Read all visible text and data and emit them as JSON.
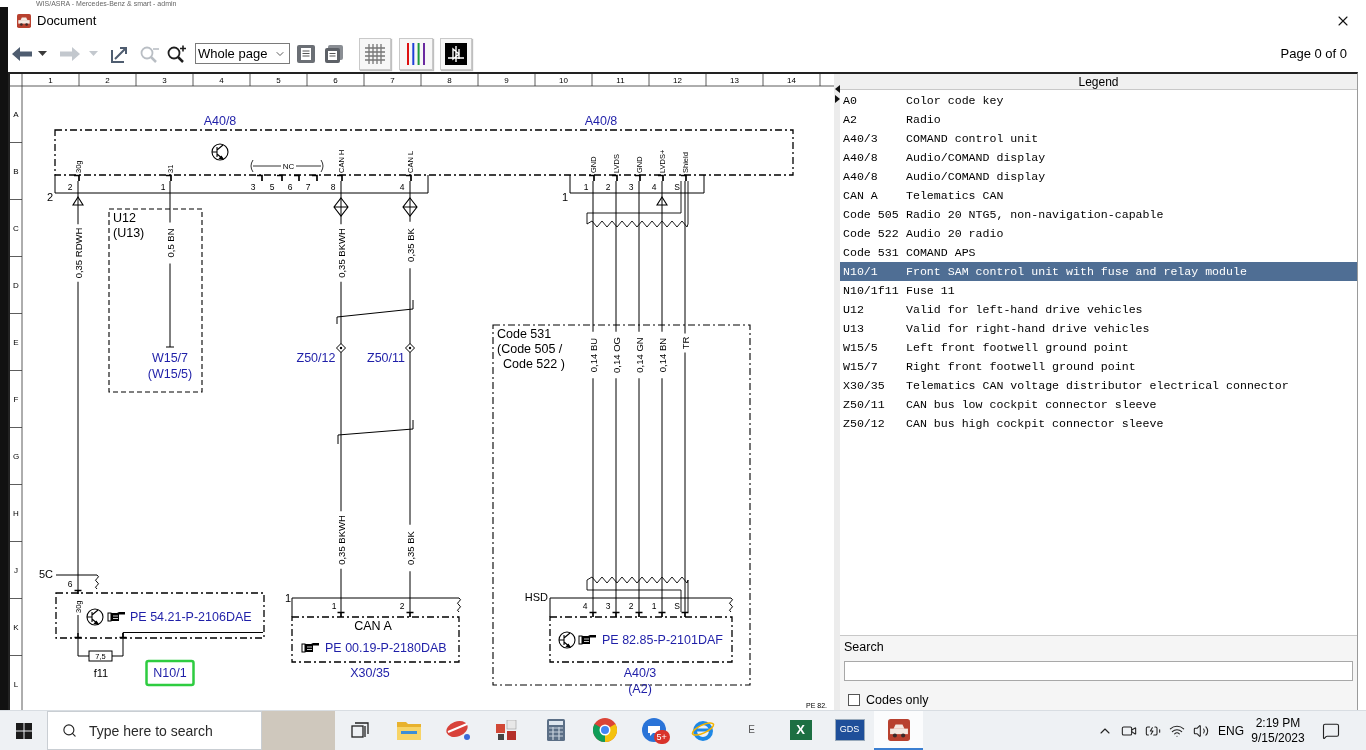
{
  "background_window": {
    "title": "WIS/ASRA - Mercedes-Benz & smart - admin"
  },
  "window": {
    "title": "Document"
  },
  "toolbar": {
    "buttons": [
      {
        "kind": "back",
        "disabled": false
      },
      {
        "kind": "menu",
        "disabled": false
      },
      {
        "kind": "forward",
        "disabled": true
      },
      {
        "kind": "menu",
        "disabled": true
      },
      {
        "kind": "fit",
        "disabled": false
      },
      {
        "kind": "zoom_out",
        "disabled": true
      },
      {
        "kind": "zoom_in",
        "disabled": false
      }
    ],
    "zoom": {
      "value": "Whole page"
    },
    "page_views": [
      {
        "kind": "single"
      },
      {
        "kind": "multiple"
      }
    ],
    "tools": [
      {
        "kind": "grid"
      },
      {
        "kind": "colors"
      },
      {
        "kind": "symbol"
      }
    ],
    "page_indicator": "Page 0 of 0"
  },
  "diagram": {
    "column_labels": [
      "1",
      "2",
      "3",
      "4",
      "5",
      "6",
      "7",
      "8",
      "9",
      "10",
      "11",
      "12",
      "13",
      "14"
    ],
    "row_labels": [
      "A",
      "B",
      "C",
      "D",
      "E",
      "F",
      "G",
      "H",
      "J",
      "K",
      "L"
    ],
    "component_labels": [
      {
        "text": "A40/8",
        "highlighted": false
      },
      {
        "text": "A40/8",
        "highlighted": false
      },
      {
        "text": "W15/7",
        "highlighted": false
      },
      {
        "text": "(W15/5)",
        "highlighted": false
      },
      {
        "text": "Z50/12",
        "highlighted": false
      },
      {
        "text": "Z50/11",
        "highlighted": false
      },
      {
        "text": "N10/1",
        "highlighted": true
      },
      {
        "text": "X30/35",
        "highlighted": false
      },
      {
        "text": "A40/3",
        "highlighted": false
      },
      {
        "text": "(A2)",
        "highlighted": false
      }
    ],
    "notes": [
      "U12",
      "(U13)",
      "Code 531",
      "(Code 505 /",
      "Code 522 )",
      "CAN A",
      "f11"
    ],
    "connectors": [
      {
        "label": "2",
        "pins": [
          {
            "number": "2",
            "name": "30g"
          },
          {
            "number": "1",
            "name": "31"
          },
          {
            "number": "3"
          },
          {
            "number": "5"
          },
          {
            "number": "6"
          },
          {
            "number": "7"
          },
          {
            "number": "8",
            "name": "CAN H"
          },
          {
            "number": "4",
            "name": "CAN L"
          }
        ]
      },
      {
        "label": "1",
        "pins": [
          {
            "number": "1",
            "name": "GND"
          },
          {
            "number": "2",
            "name": "LVDS"
          },
          {
            "number": "3",
            "name": "GND"
          },
          {
            "number": "4",
            "name": "LVDS+"
          },
          {
            "number": "S",
            "name": "Shield"
          }
        ]
      },
      {
        "label": "5C",
        "pins": [
          {
            "number": "6",
            "name": "30g"
          }
        ]
      },
      {
        "label": "1",
        "pins": [
          {
            "number": "1"
          },
          {
            "number": "2"
          }
        ]
      },
      {
        "label": "HSD",
        "pins": [
          {
            "number": "4"
          },
          {
            "number": "3"
          },
          {
            "number": "2"
          },
          {
            "number": "1"
          },
          {
            "number": "S"
          }
        ]
      }
    ],
    "no_connection": "NC",
    "wires": [
      {
        "labels": [
          "0,35 RDWH"
        ]
      },
      {
        "labels": [
          "0,5 BN"
        ]
      },
      {
        "labels": [
          "0,35 BKWH",
          "0,35 BKWH"
        ]
      },
      {
        "labels": [
          "0,35 BK",
          "0,35 BK"
        ]
      },
      {
        "labels": [
          "0,14 BU"
        ]
      },
      {
        "labels": [
          "0,14 OG"
        ]
      },
      {
        "labels": [
          "0,14 GN"
        ]
      },
      {
        "labels": [
          "0,14 BN"
        ]
      },
      {
        "labels": [
          "TR"
        ]
      }
    ],
    "references": [
      "PE 54.21-P-2106DAE",
      "PE 00.19-P-2180DAB",
      "PE 82.85-P-2101DAF"
    ],
    "fuse_rating": "7,5",
    "sheet_code": "PE 82."
  },
  "legend": {
    "title": "Legend",
    "items": [
      {
        "code": "A0",
        "description": "Color code key",
        "selected": false
      },
      {
        "code": "A2",
        "description": "Radio",
        "selected": false
      },
      {
        "code": "A40/3",
        "description": "COMAND control unit",
        "selected": false
      },
      {
        "code": "A40/8",
        "description": "Audio/COMAND display",
        "selected": false
      },
      {
        "code": "A40/8",
        "description": "Audio/COMAND display",
        "selected": false
      },
      {
        "code": "CAN A",
        "description": "Telematics CAN",
        "selected": false
      },
      {
        "code": "Code 505",
        "description": "Radio 20 NTG5, non-navigation-capable",
        "selected": false
      },
      {
        "code": "Code 522",
        "description": "Audio 20 radio",
        "selected": false
      },
      {
        "code": "Code 531",
        "description": "COMAND APS",
        "selected": false
      },
      {
        "code": "N10/1",
        "description": "Front SAM control unit with fuse and relay module",
        "selected": true
      },
      {
        "code": "N10/1f11",
        "description": "Fuse 11",
        "selected": false
      },
      {
        "code": "U12",
        "description": "Valid for left-hand drive vehicles",
        "selected": false
      },
      {
        "code": "U13",
        "description": "Valid for right-hand drive vehicles",
        "selected": false
      },
      {
        "code": "W15/5",
        "description": "Left front footwell ground point",
        "selected": false
      },
      {
        "code": "W15/7",
        "description": "Right front footwell ground point",
        "selected": false
      },
      {
        "code": "X30/35",
        "description": "Telematics CAN voltage distributor electrical connector",
        "selected": false
      },
      {
        "code": "Z50/11",
        "description": "CAN bus low cockpit connector sleeve",
        "selected": false
      },
      {
        "code": "Z50/12",
        "description": "CAN bus high cockpit connector sleeve",
        "selected": false
      }
    ],
    "search": {
      "label": "Search"
    },
    "codes_only": {
      "label": "Codes only",
      "checked": false
    }
  },
  "taskbar": {
    "search": {
      "placeholder": "Type here to search"
    },
    "apps": [
      {
        "kind": "task_view",
        "selected": false
      },
      {
        "kind": "folder",
        "selected": false
      },
      {
        "kind": "dish",
        "selected": false
      },
      {
        "kind": "tiles",
        "selected": false
      },
      {
        "kind": "calculator",
        "selected": false
      },
      {
        "kind": "browser",
        "selected": false
      },
      {
        "kind": "chat",
        "badge": "5+",
        "selected": false
      },
      {
        "kind": "globe",
        "selected": false
      },
      {
        "kind": "letter",
        "label": "E",
        "selected": false
      },
      {
        "kind": "spreadsheet",
        "label": "X",
        "selected": false
      },
      {
        "kind": "boxed_text",
        "label": "GDS",
        "selected": false
      },
      {
        "kind": "car",
        "selected": true
      }
    ],
    "tray": {
      "language": "ENG",
      "time": "2:19 PM",
      "date": "9/15/2023"
    }
  }
}
